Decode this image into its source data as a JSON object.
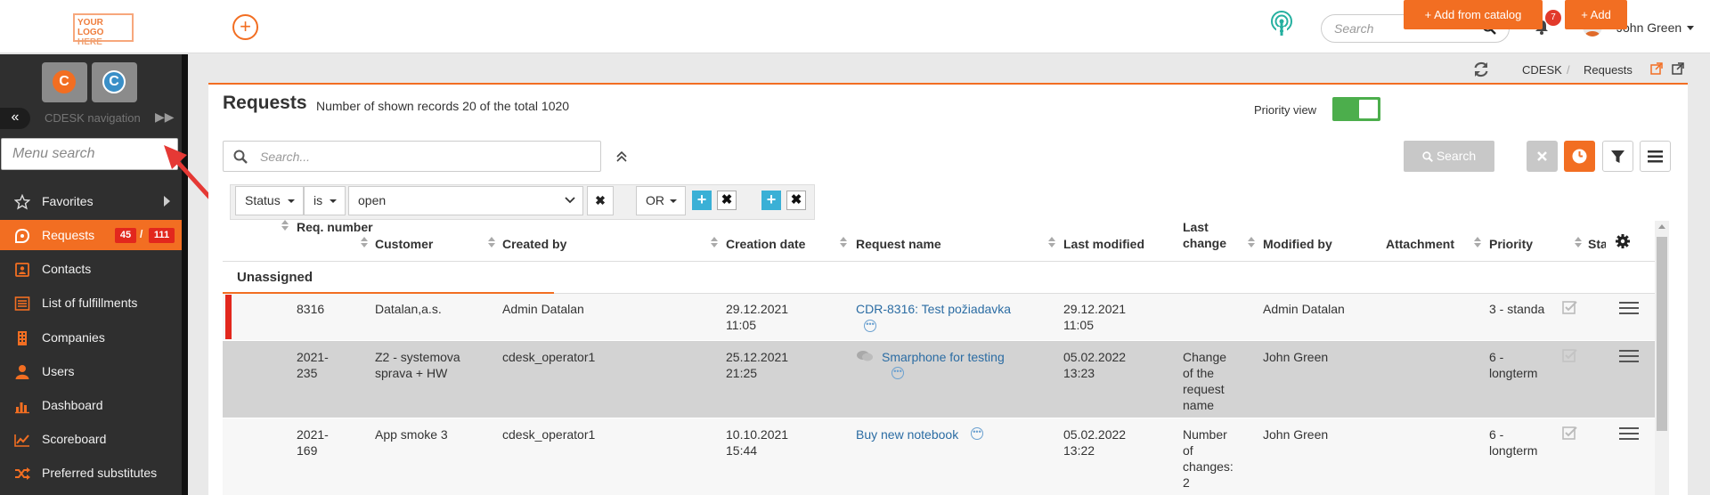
{
  "topbar": {
    "logo_line1": "YOUR LOGO",
    "logo_line2": "HERE",
    "search_placeholder": "Search",
    "notifications_count": "7",
    "user_name": "John Green",
    "accent": "#f26e22"
  },
  "sidebar": {
    "app_buttons": [
      {
        "letter": "C",
        "color": "#f26e22"
      },
      {
        "letter": "C",
        "color": "#3a8fc7"
      }
    ],
    "nav_label": "CDESK navigation",
    "menu_search_placeholder": "Menu search",
    "items": [
      {
        "label": "Favorites",
        "icon": "star-icon"
      },
      {
        "label": "Requests",
        "icon": "requests-icon",
        "active": true,
        "badge_open": "45",
        "badge_sep": "/",
        "badge_total": "111"
      },
      {
        "label": "Contacts",
        "icon": "contact-card-icon"
      },
      {
        "label": "List of fulfillments",
        "icon": "list-icon"
      },
      {
        "label": "Companies",
        "icon": "building-icon"
      },
      {
        "label": "Users",
        "icon": "user-icon"
      },
      {
        "label": "Dashboard",
        "icon": "bar-chart-icon"
      },
      {
        "label": "Scoreboard",
        "icon": "line-chart-icon"
      },
      {
        "label": "Preferred substitutes",
        "icon": "shuffle-icon"
      }
    ]
  },
  "breadcrumb": {
    "items": [
      "CDESK",
      "Requests"
    ],
    "separator": "/"
  },
  "page": {
    "title": "Requests",
    "records_info": "Number of shown records 20 of the total 1020",
    "priority_view_label": "Priority view",
    "priority_view_on": true,
    "add_from_catalog_label": "+ Add from catalog",
    "add_label": "+ Add"
  },
  "filters": {
    "search_placeholder": "Search...",
    "search_button_label": "Search",
    "field": "Status",
    "operator": "is",
    "value": "open",
    "logic": "OR"
  },
  "table": {
    "columns": [
      "Req. number",
      "Customer",
      "Created by",
      "Creation date",
      "Request name",
      "Last modified",
      "Last change",
      "Modified by",
      "Attachment",
      "Priority",
      "Sta"
    ],
    "group": "Unassigned",
    "rows": [
      {
        "number": "8316",
        "customer": "Datalan,a.s.",
        "created_by": "Admin Datalan",
        "creation_date": "29.12.2021 11:05",
        "request_name": "CDR-8316: Test požiadavka",
        "last_modified": "29.12.2021 11:05",
        "last_change": "",
        "modified_by": "Admin Datalan",
        "priority": "3 - standa"
      },
      {
        "number": "2021-235",
        "customer": "Z2 - systemova sprava + HW",
        "created_by": "cdesk_operator1",
        "creation_date": "25.12.2021 21:25",
        "request_name": "Smarphone for testing",
        "last_modified": "05.02.2022 13:23",
        "last_change": "Change of the request name",
        "modified_by": "John Green",
        "priority": "6 - longterm"
      },
      {
        "number": "2021-169",
        "customer": "App smoke 3",
        "created_by": "cdesk_operator1",
        "creation_date": "10.10.2021 15:44",
        "request_name": "Buy new notebook",
        "last_modified": "05.02.2022 13:22",
        "last_change": "Number of changes: 2",
        "modified_by": "John Green",
        "priority": "6 - longterm"
      }
    ]
  }
}
